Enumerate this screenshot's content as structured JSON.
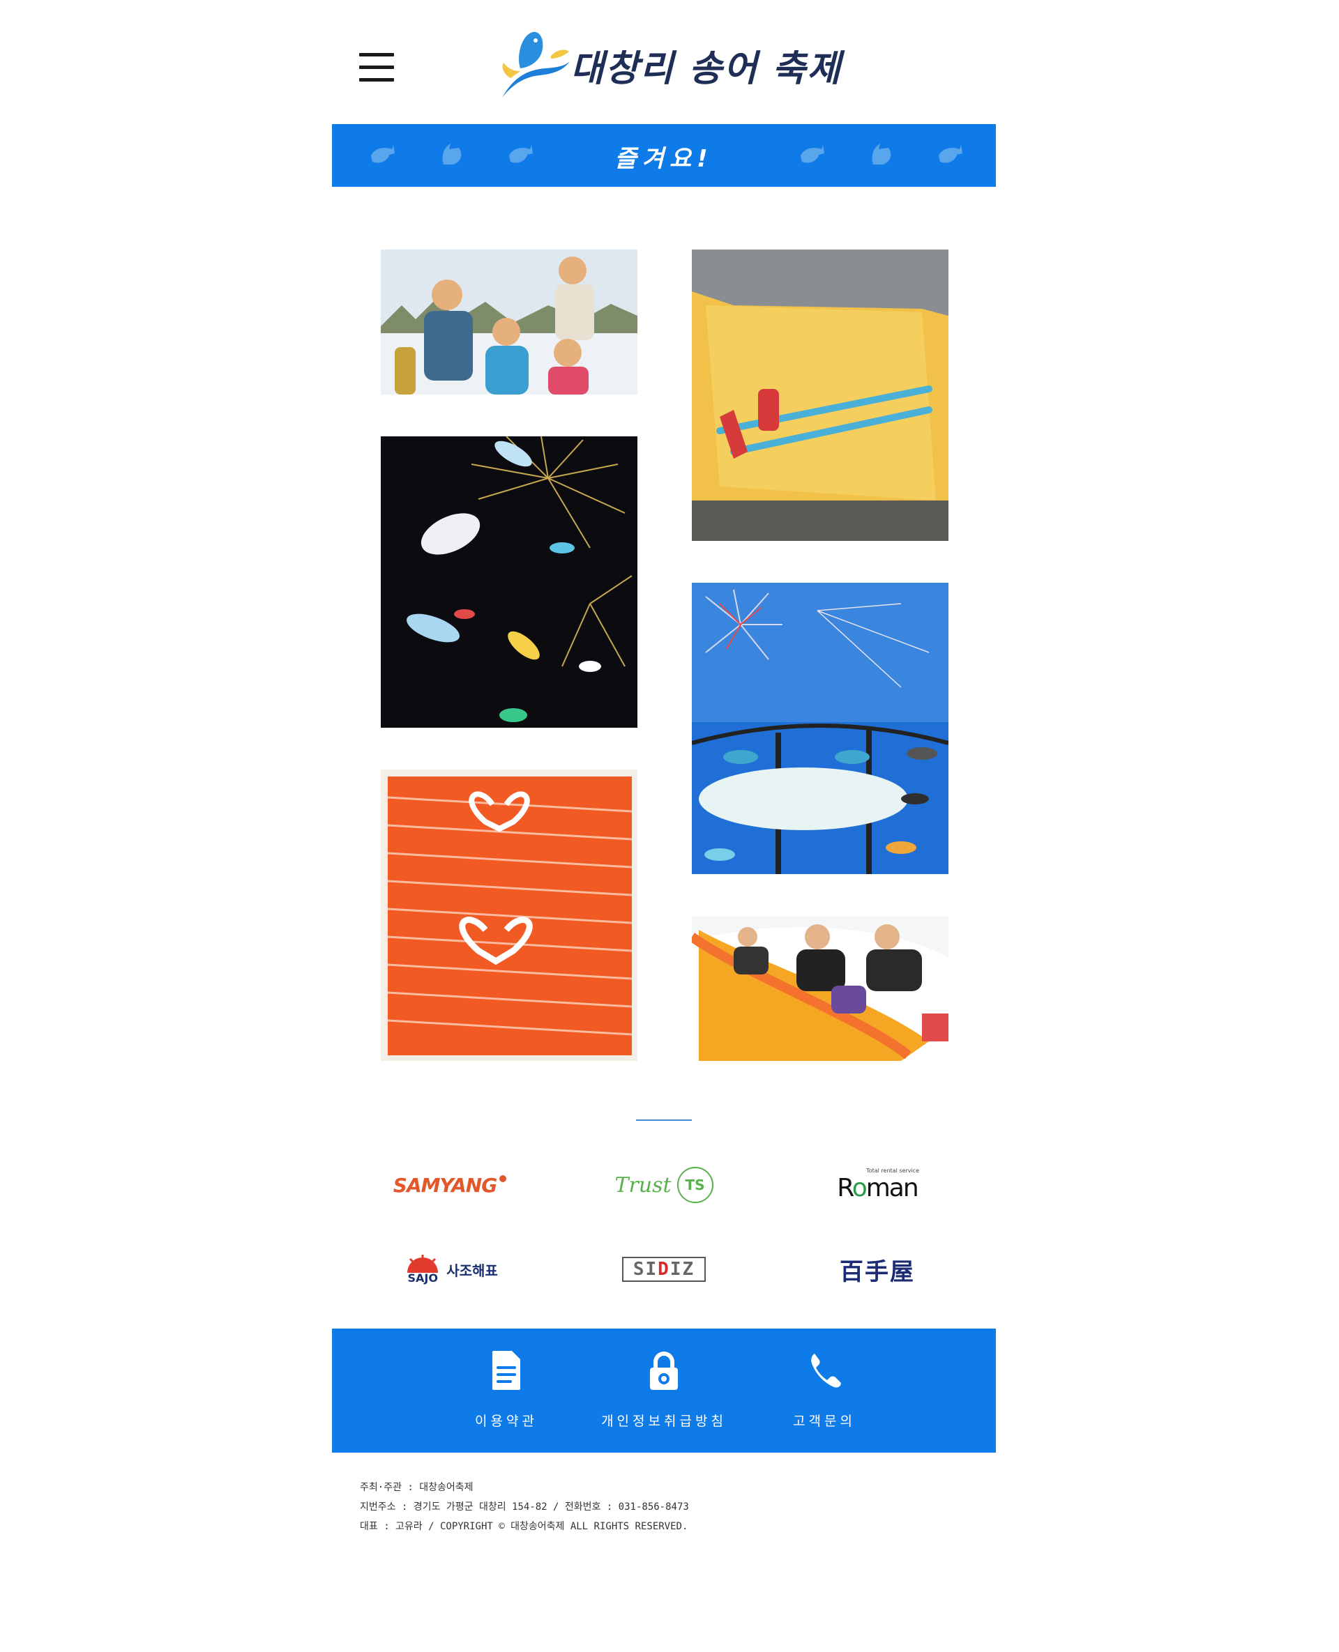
{
  "header": {
    "site_title": "대창리 송어 축제"
  },
  "band": {
    "title": "즐겨요!"
  },
  "gallery": {
    "photos": [
      {
        "name": "photo-figurines"
      },
      {
        "name": "photo-ice-fishing-rod"
      },
      {
        "name": "photo-fish-lanterns-fireworks"
      },
      {
        "name": "photo-lantern-tunnel-fireworks"
      },
      {
        "name": "photo-salmon-sashimi"
      },
      {
        "name": "photo-snow-raft-sledding"
      }
    ]
  },
  "sponsors": {
    "samyang": "SAMYANG",
    "trust": "Trust",
    "trust_badge": "TS",
    "roman_pre": "R",
    "roman_o": "o",
    "roman_post": "man",
    "roman_sub": "Total rental service",
    "sajo_logo": "SAJO",
    "sajo_text": "사조해표",
    "sidiz_pre": "SI",
    "sidiz_i": "D",
    "sidiz_post": "IZ",
    "baeksu": "百手屋"
  },
  "footer_links": {
    "terms": "이용약관",
    "privacy": "개인정보취급방침",
    "contact": "고객문의"
  },
  "info": {
    "line1": "주최·주관 : 대창송어축제",
    "line2": "지번주소 : 경기도 가평군 대창리 154-82  / 전화번호 : 031-856-8473",
    "line3": "대표 : 고유라 / COPYRIGHT © 대창송어축제 ALL RIGHTS RESERVED."
  },
  "colors": {
    "brand_blue": "#0f7be8",
    "logo_navy": "#1f2e57",
    "icons": [
      "menu-icon",
      "fish-logo-icon",
      "fish-icon",
      "document-icon",
      "lock-icon",
      "phone-icon"
    ]
  }
}
